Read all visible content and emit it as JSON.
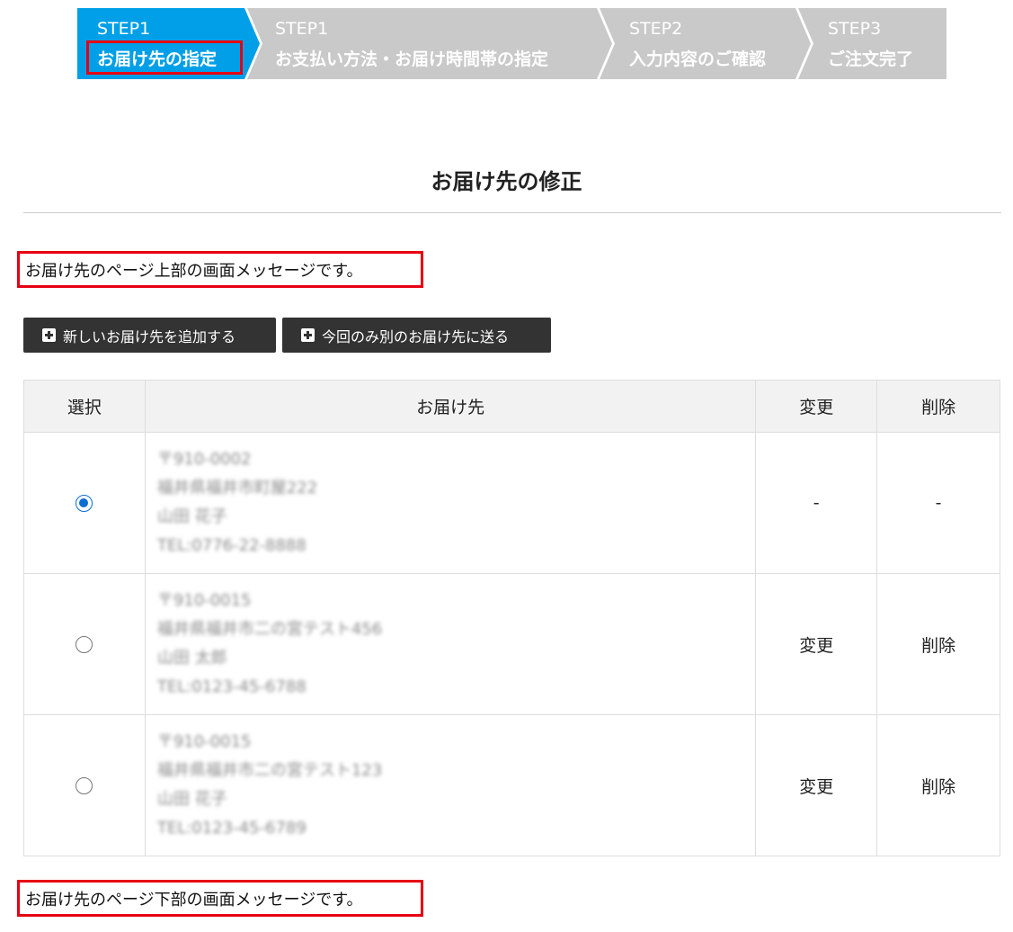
{
  "steps": [
    {
      "no": "STEP1",
      "label": "お届け先の指定",
      "active": true
    },
    {
      "no": "STEP1",
      "label": "お支払い方法・お届け時間帯の指定",
      "active": false
    },
    {
      "no": "STEP2",
      "label": "入力内容のご確認",
      "active": false
    },
    {
      "no": "STEP3",
      "label": "ご注文完了",
      "active": false
    }
  ],
  "colors": {
    "step_active": "#009fe8",
    "step_inactive": "#c9c9c9",
    "highlight": "#e60012",
    "button": "#333333"
  },
  "page_title": "お届け先の修正",
  "message_top": "お届け先のページ上部の画面メッセージです。",
  "message_bottom": "お届け先のページ下部の画面メッセージです。",
  "buttons": {
    "add_new": "新しいお届け先を追加する",
    "send_once": "今回のみ別のお届け先に送る"
  },
  "table": {
    "headers": {
      "select": "選択",
      "address": "お届け先",
      "edit": "変更",
      "delete": "削除"
    },
    "rows": [
      {
        "selected": true,
        "lines": [
          "〒910-0002",
          "福井県福井市町屋222",
          "山田 花子",
          "TEL:0776-22-8888"
        ],
        "edit": "-",
        "delete": "-"
      },
      {
        "selected": false,
        "lines": [
          "〒910-0015",
          "福井県福井市二の宮テスト456",
          "山田 太郎",
          "TEL:0123-45-6788"
        ],
        "edit": "変更",
        "delete": "削除"
      },
      {
        "selected": false,
        "lines": [
          "〒910-0015",
          "福井県福井市二の宮テスト123",
          "山田 花子",
          "TEL:0123-45-6789"
        ],
        "edit": "変更",
        "delete": "削除"
      }
    ]
  }
}
